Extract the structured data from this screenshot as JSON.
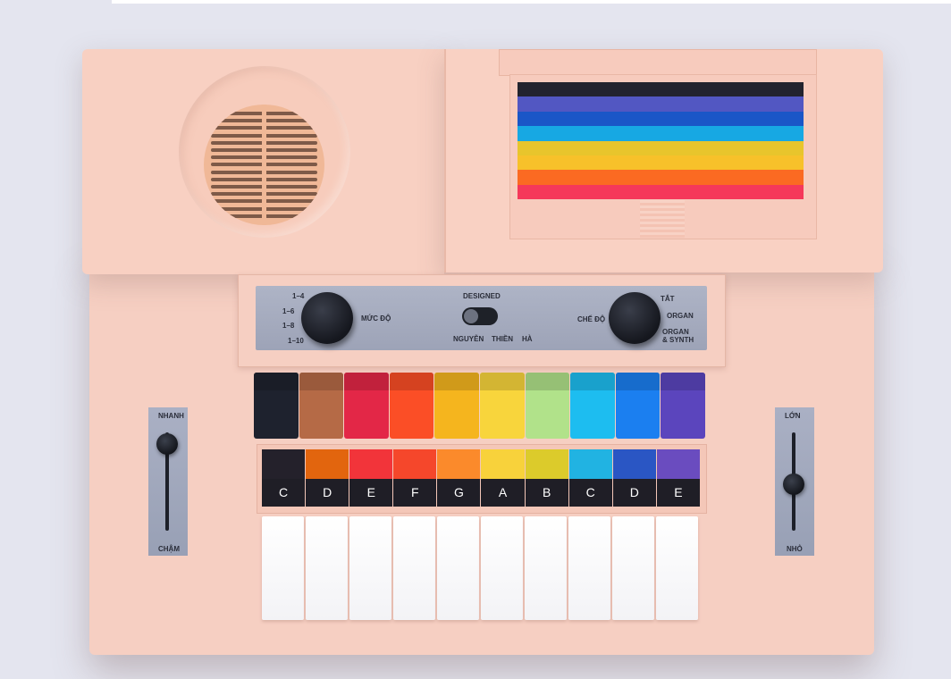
{
  "screen_colors": [
    "#22232e",
    "#5257c2",
    "#1a56c7",
    "#17a8e3",
    "#e8c52c",
    "#f7c12a",
    "#fb6a22",
    "#f5385a"
  ],
  "panel": {
    "designed": "DESIGNED",
    "level_options": [
      "1–4",
      "1–6",
      "1–8",
      "1–10"
    ],
    "level_label": "MỨC ĐỘ",
    "credit_words": [
      "NGUYỄN",
      "THIỀN",
      "HÀ"
    ],
    "mode_label": "CHẾ ĐỘ",
    "mode_options": [
      "TẮT",
      "ORGAN",
      "ORGAN",
      "& SYNTH"
    ]
  },
  "tempo_slider": {
    "top_label": "NHANH",
    "bottom_label": "CHẬM",
    "level": 0.88
  },
  "volume_slider": {
    "top_label": "LỚN",
    "bottom_label": "NHỎ",
    "level": 0.47
  },
  "pads": [
    "#1e222e",
    "#b56a46",
    "#e32747",
    "#fb4e26",
    "#f5b51e",
    "#f8d53c",
    "#b1e28a",
    "#1dbdf0",
    "#1b7ff0",
    "#5b45bd"
  ],
  "notes": [
    {
      "name": "C",
      "color": "#24212b"
    },
    {
      "name": "D",
      "color": "#e2650e"
    },
    {
      "name": "E",
      "color": "#f2343a"
    },
    {
      "name": "F",
      "color": "#f5472b"
    },
    {
      "name": "G",
      "color": "#fb8a2b"
    },
    {
      "name": "A",
      "color": "#f8d23b"
    },
    {
      "name": "B",
      "color": "#dccb2b"
    },
    {
      "name": "C",
      "color": "#21b3e2"
    },
    {
      "name": "D",
      "color": "#2a56c4"
    },
    {
      "name": "E",
      "color": "#6a4cbf"
    }
  ],
  "white_key_count": 10
}
